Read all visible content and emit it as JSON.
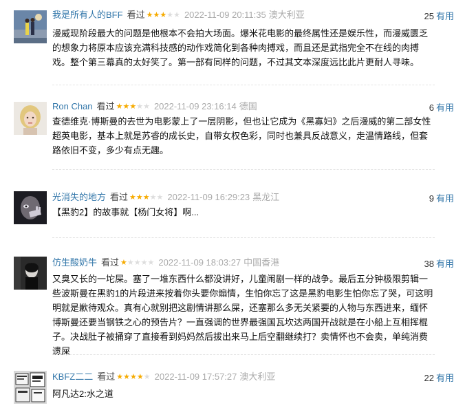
{
  "reviews": [
    {
      "user": "我是所有人的BFF",
      "action": "看过",
      "rating": 3,
      "time": "2022-11-09 20:11:35",
      "location": "澳大利亚",
      "votes": "25",
      "useful_label": "有用",
      "content": "漫威现阶段最大的问题是他根本不会拍大场面。爆米花电影的最终属性还是娱乐性，而漫威匮乏的想象力将原本应该充满科技感的动作戏简化到各种肉搏戏，而且还是武指完全不在线的肉搏戏。整个第三幕真的太好笑了。第一部有同样的问题，不过其文本深度远比此片更耐人寻味。",
      "avatar_icon": "couple-dancing-photo-icon"
    },
    {
      "user": "Ron Chan",
      "action": "看过",
      "rating": 3,
      "time": "2022-11-09 23:16:14",
      "location": "德国",
      "votes": "6",
      "useful_label": "有用",
      "content": "查德维克·博斯曼的去世为电影蒙上了一层阴影，但也让它成为《黑寡妇》之后漫威的第二部女性超英电影，基本上就是苏睿的成长史，自带女权色彩，同时也兼具反战意义，走温情路线，但套路依旧不变，多少有点无趣。",
      "avatar_icon": "blonde-woman-photo-icon"
    },
    {
      "user": "光消失的地方",
      "action": "看过",
      "rating": 3,
      "time": "2022-11-09 16:29:23",
      "location": "黑龙江",
      "votes": "9",
      "useful_label": "有用",
      "content": "【黑豹2】的故事就【杨门女将】啊...",
      "avatar_icon": "face-with-hand-photo-icon"
    },
    {
      "user": "仿生酸奶牛",
      "action": "看过",
      "rating": 1,
      "time": "2022-11-09 18:03:27",
      "location": "中国香港",
      "votes": "38",
      "useful_label": "有用",
      "content": "又臭又长的一坨屎。塞了一堆东西什么都没讲好，儿童闹剧一样的战争。最后五分钟极限剪辑一些波斯曼在黑豹1的片段进来按着你头要你煽情，生怕你忘了这是黑豹电影生怕你忘了哭，可这明明就是歉待观众。真有心就别把这剧情讲那么屎，还塞那么多无关紧要的人物与东西进来，缅怀博斯曼还要当钢铁之心的预告片？一直强调的世界最强国瓦坎达两国开战就是在小船上互相挥棍子。决战肚子被捅穿了直接看到妈妈然后拔出来马上后空翻继续打？卖情怀也不会卖，单纯消费遗屎",
      "avatar_icon": "dark-figure-photo-icon"
    },
    {
      "user": "KBFZ二二",
      "action": "看过",
      "rating": 4,
      "time": "2022-11-09 17:57:27",
      "location": "澳大利亚",
      "votes": "22",
      "useful_label": "有用",
      "content": "阿凡达2:水之道",
      "avatar_icon": "newspaper-collage-icon"
    }
  ]
}
